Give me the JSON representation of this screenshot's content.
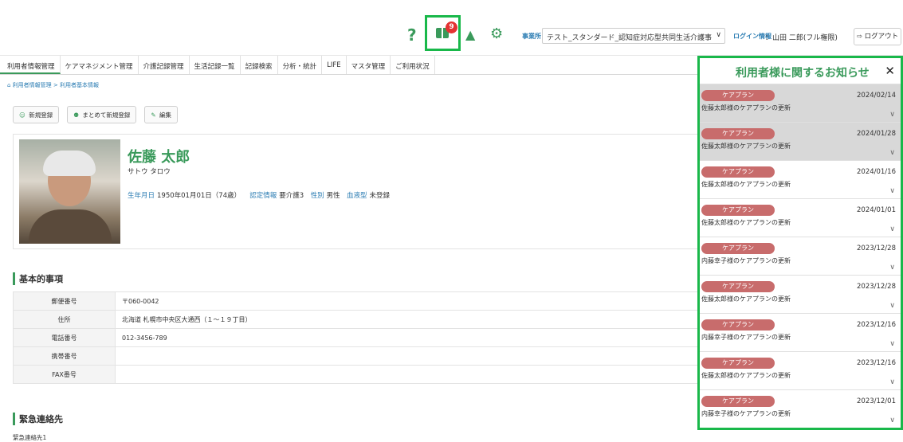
{
  "header": {
    "help_icon": "?",
    "notice_count": "9",
    "bell_icon": "▲",
    "gear_icon": "⚙",
    "office_label": "事業所",
    "office_value": "テスト_スタンダード_認知症対応型共同生活介護事",
    "select_chevron": "∨",
    "login_label": "ログイン情報",
    "login_value": "：山田 二郎(フル権限)",
    "logout_label": "⇨ ログアウト"
  },
  "nav": {
    "items": [
      "利用者情報管理",
      "ケアマネジメント管理",
      "介護記録管理",
      "生活記録一覧",
      "記録検索",
      "分析・統計",
      "LIFE",
      "マスタ管理",
      "ご利用状況"
    ]
  },
  "breadcrumb": {
    "home_icon": "⌂",
    "text": "利用者情報管理 > 利用者基本情報"
  },
  "actions": {
    "new_icon": "☺",
    "new_label": "新規登録",
    "bulk_icon": "⚉",
    "bulk_label": "まとめて新規登録",
    "edit_icon": "✎",
    "edit_label": "編集"
  },
  "profile": {
    "name": "佐藤 太郎",
    "kana": "サトウ タロウ",
    "birth_label": "生年月日",
    "birth_value": "1950年01月01日（74歳）",
    "cert_label": "認定情報",
    "cert_value": "要介護3",
    "gender_label": "性別",
    "gender_value": "男性",
    "blood_label": "血液型",
    "blood_value": "未登録"
  },
  "basic": {
    "title": "基本的事項",
    "rows": [
      {
        "label": "郵便番号",
        "value": "〒060-0042"
      },
      {
        "label": "住所",
        "value": "北海道 札幌市中央区大通西（１～１９丁目）"
      },
      {
        "label": "電話番号",
        "value": "012-3456-789"
      },
      {
        "label": "携帯番号",
        "value": ""
      },
      {
        "label": "FAX番号",
        "value": ""
      }
    ]
  },
  "emergency": {
    "title": "緊急連絡先",
    "sub": "緊急連絡先1"
  },
  "panel": {
    "title": "利用者様に関するお知らせ",
    "close_icon": "✕",
    "chevron": "∨",
    "notices": [
      {
        "tag": "ケアプラン",
        "date": "2024/02/14",
        "text": "佐藤太郎様のケアプランの更新",
        "read": true
      },
      {
        "tag": "ケアプラン",
        "date": "2024/01/28",
        "text": "佐藤太郎様のケアプランの更新",
        "read": true
      },
      {
        "tag": "ケアプラン",
        "date": "2024/01/16",
        "text": "佐藤太郎様のケアプランの更新",
        "read": false
      },
      {
        "tag": "ケアプラン",
        "date": "2024/01/01",
        "text": "佐藤太郎様のケアプランの更新",
        "read": false
      },
      {
        "tag": "ケアプラン",
        "date": "2023/12/28",
        "text": "内藤幸子様のケアプランの更新",
        "read": false
      },
      {
        "tag": "ケアプラン",
        "date": "2023/12/28",
        "text": "佐藤太郎様のケアプランの更新",
        "read": false
      },
      {
        "tag": "ケアプラン",
        "date": "2023/12/16",
        "text": "内藤幸子様のケアプランの更新",
        "read": false
      },
      {
        "tag": "ケアプラン",
        "date": "2023/12/16",
        "text": "佐藤太郎様のケアプランの更新",
        "read": false
      },
      {
        "tag": "ケアプラン",
        "date": "2023/12/01",
        "text": "内藤幸子様のケアプランの更新",
        "read": false
      }
    ]
  }
}
